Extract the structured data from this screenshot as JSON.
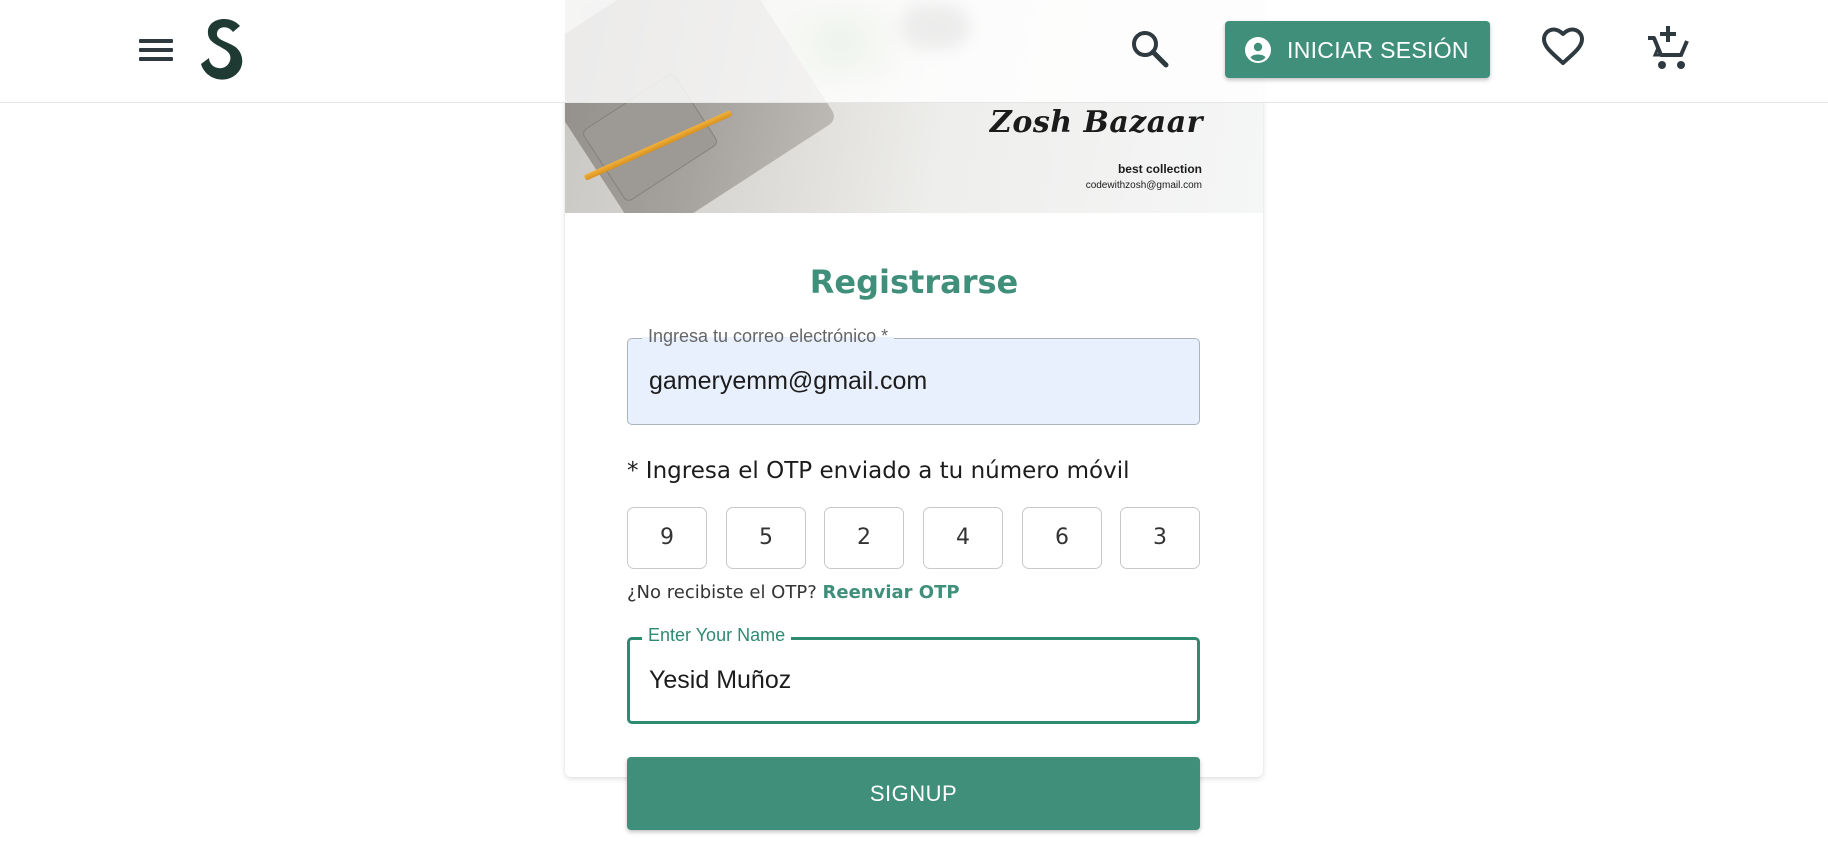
{
  "header": {
    "login_label": "INICIAR SESIÓN",
    "icons": [
      "menu-icon",
      "logo",
      "search-icon",
      "user-circle-icon",
      "heart-icon",
      "cart-plus-icon"
    ]
  },
  "banner": {
    "brand": "Zosh Bazaar",
    "tagline": "best collection",
    "email": "codewithzosh@gmail.com"
  },
  "form": {
    "title": "Registrarse",
    "email_label": "Ingresa tu correo electrónico *",
    "email_value": "gameryemm@gmail.com",
    "otp_label": "* Ingresa el OTP enviado a tu número móvil",
    "otp_digits": [
      "9",
      "5",
      "2",
      "4",
      "6",
      "3"
    ],
    "resend_prompt": "¿No recibiste el OTP?",
    "resend_link": "Reenviar OTP",
    "name_label": "Enter Your Name",
    "name_value": "Yesid Muñoz",
    "signup_label": "SIGNUP"
  },
  "colors": {
    "accent": "#3f8f7a",
    "dark": "#1e3a32",
    "autofill_bg": "#e8f0fe"
  }
}
